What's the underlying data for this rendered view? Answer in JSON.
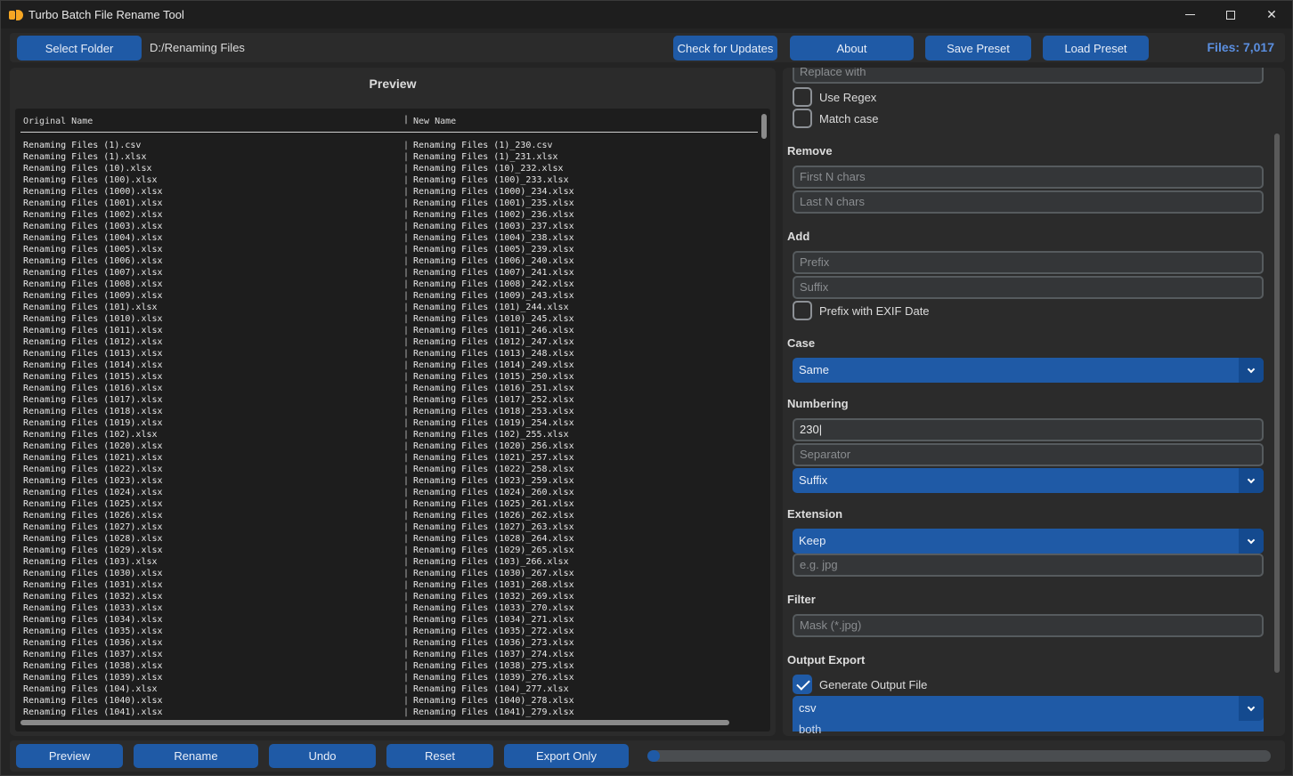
{
  "window": {
    "title": "Turbo Batch File Rename Tool"
  },
  "toolbar": {
    "select_folder": "Select Folder",
    "folder_path": "D:/Renaming Files",
    "check_updates": "Check for Updates",
    "about": "About",
    "save_preset": "Save Preset",
    "load_preset": "Load Preset",
    "files_count": "Files: 7,017"
  },
  "preview": {
    "title": "Preview",
    "col_original": "Original Name",
    "col_new": "New Name",
    "separator": "|",
    "rows": [
      [
        "Renaming Files (1).csv",
        "Renaming Files (1)_230.csv"
      ],
      [
        "Renaming Files (1).xlsx",
        "Renaming Files (1)_231.xlsx"
      ],
      [
        "Renaming Files (10).xlsx",
        "Renaming Files (10)_232.xlsx"
      ],
      [
        "Renaming Files (100).xlsx",
        "Renaming Files (100)_233.xlsx"
      ],
      [
        "Renaming Files (1000).xlsx",
        "Renaming Files (1000)_234.xlsx"
      ],
      [
        "Renaming Files (1001).xlsx",
        "Renaming Files (1001)_235.xlsx"
      ],
      [
        "Renaming Files (1002).xlsx",
        "Renaming Files (1002)_236.xlsx"
      ],
      [
        "Renaming Files (1003).xlsx",
        "Renaming Files (1003)_237.xlsx"
      ],
      [
        "Renaming Files (1004).xlsx",
        "Renaming Files (1004)_238.xlsx"
      ],
      [
        "Renaming Files (1005).xlsx",
        "Renaming Files (1005)_239.xlsx"
      ],
      [
        "Renaming Files (1006).xlsx",
        "Renaming Files (1006)_240.xlsx"
      ],
      [
        "Renaming Files (1007).xlsx",
        "Renaming Files (1007)_241.xlsx"
      ],
      [
        "Renaming Files (1008).xlsx",
        "Renaming Files (1008)_242.xlsx"
      ],
      [
        "Renaming Files (1009).xlsx",
        "Renaming Files (1009)_243.xlsx"
      ],
      [
        "Renaming Files (101).xlsx",
        "Renaming Files (101)_244.xlsx"
      ],
      [
        "Renaming Files (1010).xlsx",
        "Renaming Files (1010)_245.xlsx"
      ],
      [
        "Renaming Files (1011).xlsx",
        "Renaming Files (1011)_246.xlsx"
      ],
      [
        "Renaming Files (1012).xlsx",
        "Renaming Files (1012)_247.xlsx"
      ],
      [
        "Renaming Files (1013).xlsx",
        "Renaming Files (1013)_248.xlsx"
      ],
      [
        "Renaming Files (1014).xlsx",
        "Renaming Files (1014)_249.xlsx"
      ],
      [
        "Renaming Files (1015).xlsx",
        "Renaming Files (1015)_250.xlsx"
      ],
      [
        "Renaming Files (1016).xlsx",
        "Renaming Files (1016)_251.xlsx"
      ],
      [
        "Renaming Files (1017).xlsx",
        "Renaming Files (1017)_252.xlsx"
      ],
      [
        "Renaming Files (1018).xlsx",
        "Renaming Files (1018)_253.xlsx"
      ],
      [
        "Renaming Files (1019).xlsx",
        "Renaming Files (1019)_254.xlsx"
      ],
      [
        "Renaming Files (102).xlsx",
        "Renaming Files (102)_255.xlsx"
      ],
      [
        "Renaming Files (1020).xlsx",
        "Renaming Files (1020)_256.xlsx"
      ],
      [
        "Renaming Files (1021).xlsx",
        "Renaming Files (1021)_257.xlsx"
      ],
      [
        "Renaming Files (1022).xlsx",
        "Renaming Files (1022)_258.xlsx"
      ],
      [
        "Renaming Files (1023).xlsx",
        "Renaming Files (1023)_259.xlsx"
      ],
      [
        "Renaming Files (1024).xlsx",
        "Renaming Files (1024)_260.xlsx"
      ],
      [
        "Renaming Files (1025).xlsx",
        "Renaming Files (1025)_261.xlsx"
      ],
      [
        "Renaming Files (1026).xlsx",
        "Renaming Files (1026)_262.xlsx"
      ],
      [
        "Renaming Files (1027).xlsx",
        "Renaming Files (1027)_263.xlsx"
      ],
      [
        "Renaming Files (1028).xlsx",
        "Renaming Files (1028)_264.xlsx"
      ],
      [
        "Renaming Files (1029).xlsx",
        "Renaming Files (1029)_265.xlsx"
      ],
      [
        "Renaming Files (103).xlsx",
        "Renaming Files (103)_266.xlsx"
      ],
      [
        "Renaming Files (1030).xlsx",
        "Renaming Files (1030)_267.xlsx"
      ],
      [
        "Renaming Files (1031).xlsx",
        "Renaming Files (1031)_268.xlsx"
      ],
      [
        "Renaming Files (1032).xlsx",
        "Renaming Files (1032)_269.xlsx"
      ],
      [
        "Renaming Files (1033).xlsx",
        "Renaming Files (1033)_270.xlsx"
      ],
      [
        "Renaming Files (1034).xlsx",
        "Renaming Files (1034)_271.xlsx"
      ],
      [
        "Renaming Files (1035).xlsx",
        "Renaming Files (1035)_272.xlsx"
      ],
      [
        "Renaming Files (1036).xlsx",
        "Renaming Files (1036)_273.xlsx"
      ],
      [
        "Renaming Files (1037).xlsx",
        "Renaming Files (1037)_274.xlsx"
      ],
      [
        "Renaming Files (1038).xlsx",
        "Renaming Files (1038)_275.xlsx"
      ],
      [
        "Renaming Files (1039).xlsx",
        "Renaming Files (1039)_276.xlsx"
      ],
      [
        "Renaming Files (104).xlsx",
        "Renaming Files (104)_277.xlsx"
      ],
      [
        "Renaming Files (1040).xlsx",
        "Renaming Files (1040)_278.xlsx"
      ],
      [
        "Renaming Files (1041).xlsx",
        "Renaming Files (1041)_279.xlsx"
      ]
    ]
  },
  "options": {
    "replace_with_placeholder": "Replace with",
    "use_regex": "Use Regex",
    "match_case": "Match case",
    "remove_label": "Remove",
    "first_n_placeholder": "First N chars",
    "last_n_placeholder": "Last N chars",
    "add_label": "Add",
    "prefix_placeholder": "Prefix",
    "suffix_placeholder": "Suffix",
    "exif_label": "Prefix with EXIF Date",
    "case_label": "Case",
    "case_value": "Same",
    "numbering_label": "Numbering",
    "numbering_start": "230",
    "separator_placeholder": "Separator",
    "numbering_position": "Suffix",
    "extension_label": "Extension",
    "extension_mode": "Keep",
    "extension_placeholder": "e.g. jpg",
    "filter_label": "Filter",
    "filter_placeholder": "Mask (*.jpg)",
    "output_label": "Output Export",
    "generate_output": "Generate Output File",
    "generate_output_checked": true,
    "output_format": "csv",
    "output_next_option": "both"
  },
  "bottom": {
    "preview": "Preview",
    "rename": "Rename",
    "undo": "Undo",
    "reset": "Reset",
    "export_only": "Export Only",
    "progress": 0.02
  },
  "colors": {
    "accent": "#1f5aa6",
    "files_count": "#5b8fe0",
    "app_icon": "#f5a623"
  }
}
